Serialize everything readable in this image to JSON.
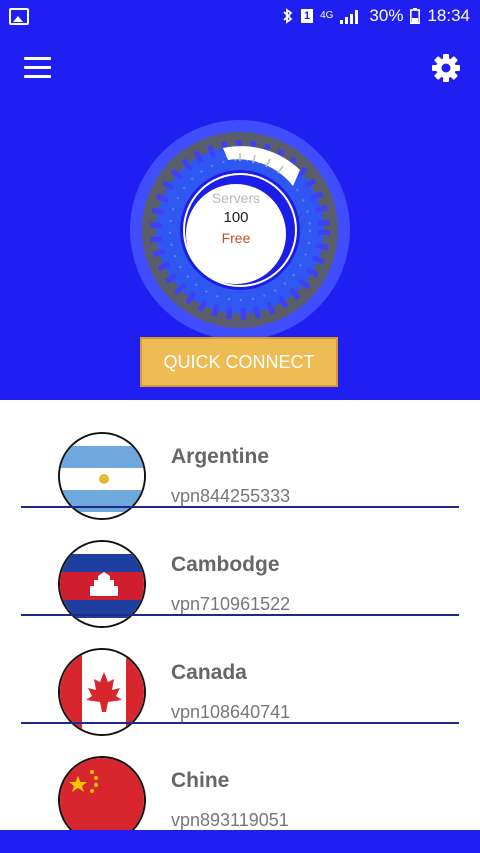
{
  "status_bar": {
    "battery_percent": "30%",
    "time": "18:34",
    "network": "4G",
    "sim_slot": "1",
    "icons": [
      "gallery-icon",
      "bluetooth-icon",
      "sim-icon",
      "signal-icon",
      "battery-icon"
    ]
  },
  "toolbar": {
    "menu_icon": "menu-icon",
    "settings_icon": "gear-icon"
  },
  "gauge": {
    "label": "Servers",
    "count": "100",
    "tier": "Free"
  },
  "quick_connect": {
    "label": "QUICK CONNECT"
  },
  "servers": [
    {
      "country": "Argentine",
      "id": "vpn844255333",
      "flag": "argentina-flag"
    },
    {
      "country": "Cambodge",
      "id": "vpn710961522",
      "flag": "cambodia-flag"
    },
    {
      "country": "Canada",
      "id": "vpn108640741",
      "flag": "canada-flag"
    },
    {
      "country": "Chine",
      "id": "vpn893119051",
      "flag": "china-flag"
    }
  ],
  "colors": {
    "background": "#1e1ff0",
    "button": "#eebb55",
    "divider": "#1f2a88"
  }
}
